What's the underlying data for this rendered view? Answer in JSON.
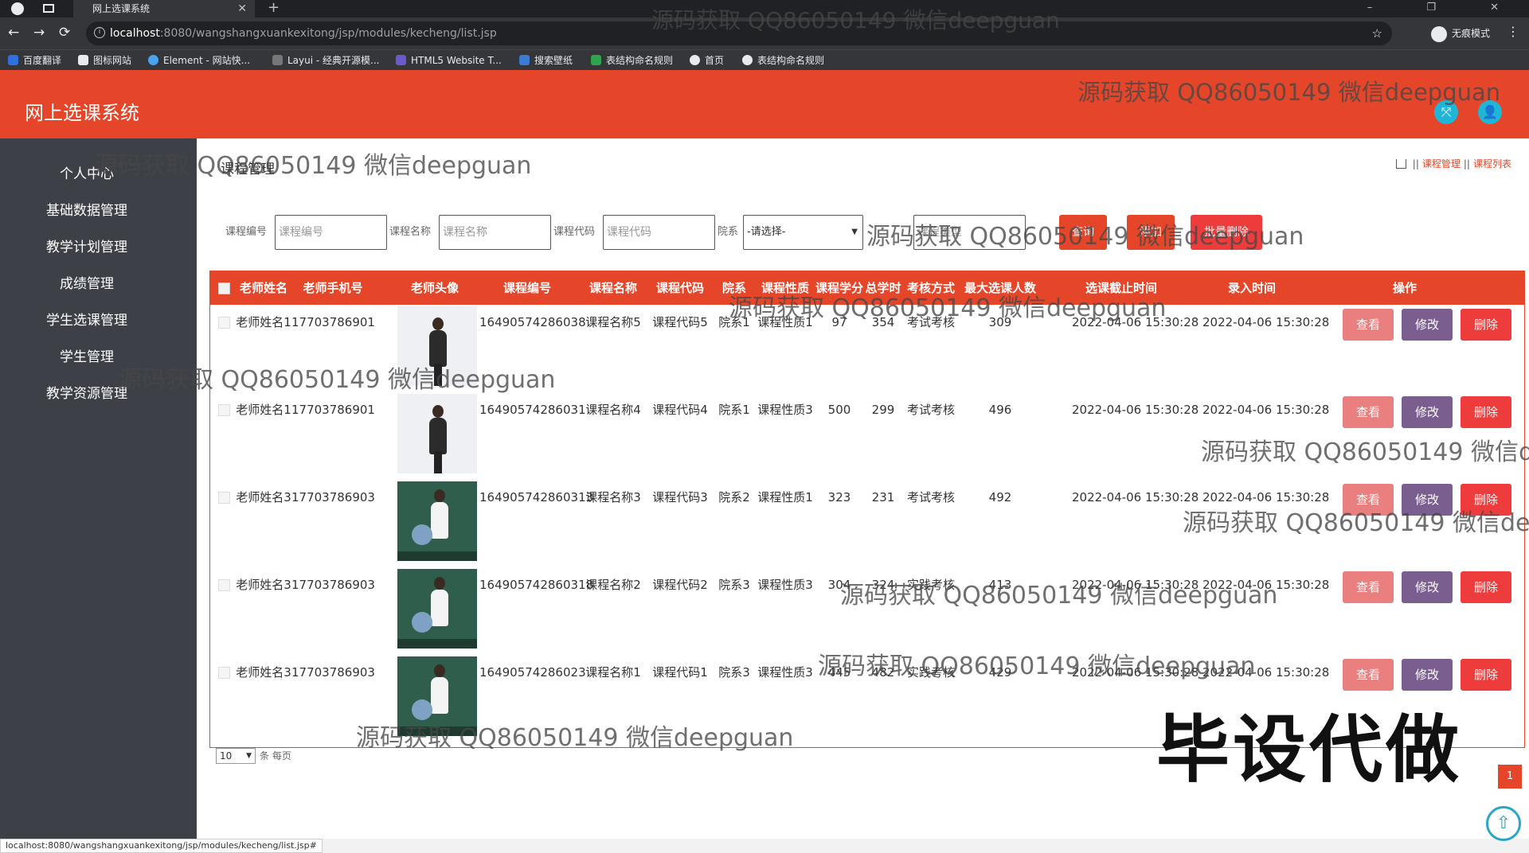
{
  "browser": {
    "tab_title": "网上选课系统",
    "tab_close": "✕",
    "new_tab": "+",
    "window_controls": "– ❐ ✕",
    "url_host": "localhost",
    "url_path": ":8080/wangshangxuankexitong/jsp/modules/kecheng/list.jsp",
    "incognito_label": "无痕模式",
    "bookmarks": [
      "百度翻译",
      "图标网站",
      "Element - 网站快...",
      "Layui - 经典开源模...",
      "HTML5 Website T...",
      "搜索壁纸",
      "表结构命名规则",
      "首页",
      "表结构命名规则"
    ],
    "status_url": "localhost:8080/wangshangxuankexitong/jsp/modules/kecheng/list.jsp#"
  },
  "header": {
    "title": "网上选课系统",
    "fullscreen_icon": "⤧",
    "user_icon": "👤",
    "accent_color": "#e5462a"
  },
  "sidebar": {
    "items": [
      {
        "label": "个人中心"
      },
      {
        "label": "基础数据管理"
      },
      {
        "label": "教学计划管理"
      },
      {
        "label": "成绩管理"
      },
      {
        "label": "学生选课管理"
      },
      {
        "label": "学生管理"
      },
      {
        "label": "教学资源管理"
      }
    ]
  },
  "main": {
    "page_title": "课程管理",
    "breadcrumb": {
      "sep": "||",
      "items": [
        "课程管理",
        "课程列表"
      ]
    },
    "search": {
      "course_no_label": "课程编号",
      "course_no_placeholder": "课程编号",
      "course_name_label": "课程名称",
      "course_name_placeholder": "课程名称",
      "course_code_label": "课程代码",
      "course_code_placeholder": "课程代码",
      "college_label": "院系",
      "college_value": "-请选择-",
      "extra_placeholder": "课程类型",
      "search_button": "查询",
      "add_button": "添加",
      "delete_button": "批量删除"
    },
    "table": {
      "headers": [
        "老师姓名",
        "老师手机号",
        "老师头像",
        "课程编号",
        "课程名称",
        "课程代码",
        "院系",
        "课程性质",
        "课程学分",
        "总学时",
        "考核方式",
        "最大选课人数",
        "选课截止时间",
        "录入时间",
        "操作"
      ],
      "rows": [
        {
          "teacher": "老师姓名1",
          "phone": "17703786901",
          "avatar": "light",
          "course_no": "16490574286038",
          "name": "课程名称5",
          "code": "课程代码5",
          "college": "院系1",
          "nature": "课程性质1",
          "credit": "97",
          "hours": "354",
          "exam": "考试考核",
          "max": "309",
          "deadline": "2022-04-06 15:30:28",
          "created": "2022-04-06 15:30:28"
        },
        {
          "teacher": "老师姓名1",
          "phone": "17703786901",
          "avatar": "light",
          "course_no": "16490574286031",
          "name": "课程名称4",
          "code": "课程代码4",
          "college": "院系1",
          "nature": "课程性质3",
          "credit": "500",
          "hours": "299",
          "exam": "考试考核",
          "max": "496",
          "deadline": "2022-04-06 15:30:28",
          "created": "2022-04-06 15:30:28"
        },
        {
          "teacher": "老师姓名3",
          "phone": "17703786903",
          "avatar": "dark",
          "course_no": "164905742860313",
          "name": "课程名称3",
          "code": "课程代码3",
          "college": "院系2",
          "nature": "课程性质1",
          "credit": "323",
          "hours": "231",
          "exam": "考试考核",
          "max": "492",
          "deadline": "2022-04-06 15:30:28",
          "created": "2022-04-06 15:30:28"
        },
        {
          "teacher": "老师姓名3",
          "phone": "17703786903",
          "avatar": "dark",
          "course_no": "164905742860318",
          "name": "课程名称2",
          "code": "课程代码2",
          "college": "院系3",
          "nature": "课程性质3",
          "credit": "304",
          "hours": "324",
          "exam": "实践考核",
          "max": "413",
          "deadline": "2022-04-06 15:30:28",
          "created": "2022-04-06 15:30:28"
        },
        {
          "teacher": "老师姓名3",
          "phone": "17703786903",
          "avatar": "dark",
          "course_no": "16490574286023",
          "name": "课程名称1",
          "code": "课程代码1",
          "college": "院系3",
          "nature": "课程性质3",
          "credit": "445",
          "hours": "482",
          "exam": "实践考核",
          "max": "429",
          "deadline": "2022-04-06 15:30:28",
          "created": "2022-04-06 15:30:28"
        }
      ],
      "actions": {
        "view": "查看",
        "edit": "修改",
        "delete": "删除"
      }
    },
    "pager": {
      "page_size": "10",
      "per_page_text": "条 每页",
      "current_page": "1"
    },
    "back_to_top_icon": "⇧"
  },
  "watermark": {
    "text": "源码获取 QQ86050149 微信deepguan",
    "big_text": "毕设代做"
  }
}
